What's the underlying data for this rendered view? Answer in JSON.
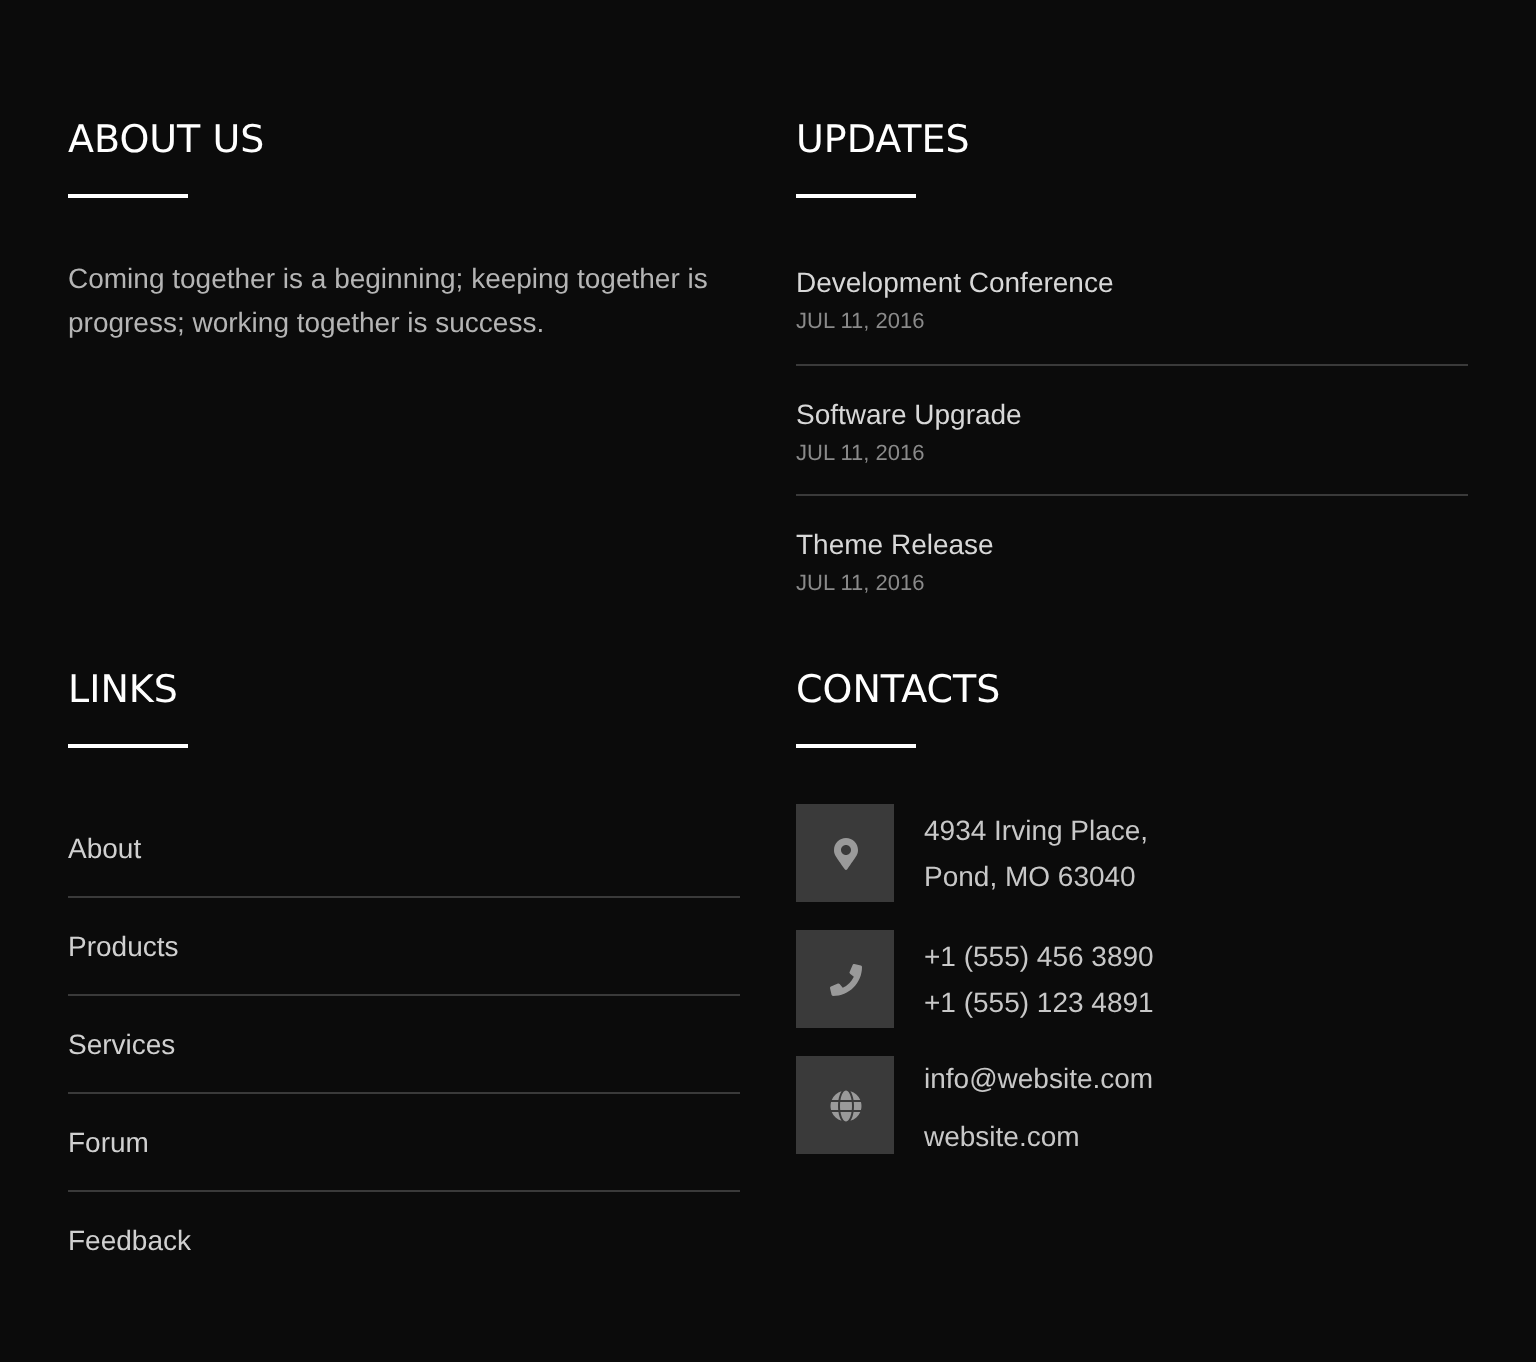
{
  "about": {
    "title": "ABOUT US",
    "text": "Coming together is a beginning; keeping together is progress; working together is success."
  },
  "updates": {
    "title": "UPDATES",
    "items": [
      {
        "title": "Development Conference",
        "date": "JUL 11, 2016"
      },
      {
        "title": "Software Upgrade",
        "date": "JUL 11, 2016"
      },
      {
        "title": "Theme Release",
        "date": "JUL 11, 2016"
      }
    ]
  },
  "links": {
    "title": "LINKS",
    "items": [
      "About",
      "Products",
      "Services",
      "Forum",
      "Feedback"
    ]
  },
  "contacts": {
    "title": "CONTACTS",
    "items": [
      {
        "kind": "address",
        "lines": [
          "4934 Irving Place,",
          "Pond, MO 63040"
        ]
      },
      {
        "kind": "phone",
        "lines": [
          "+1 (555) 456 3890",
          "+1 (555) 123 4891"
        ]
      },
      {
        "kind": "web",
        "lines": [
          "info@website.com",
          "website.com"
        ]
      }
    ]
  }
}
